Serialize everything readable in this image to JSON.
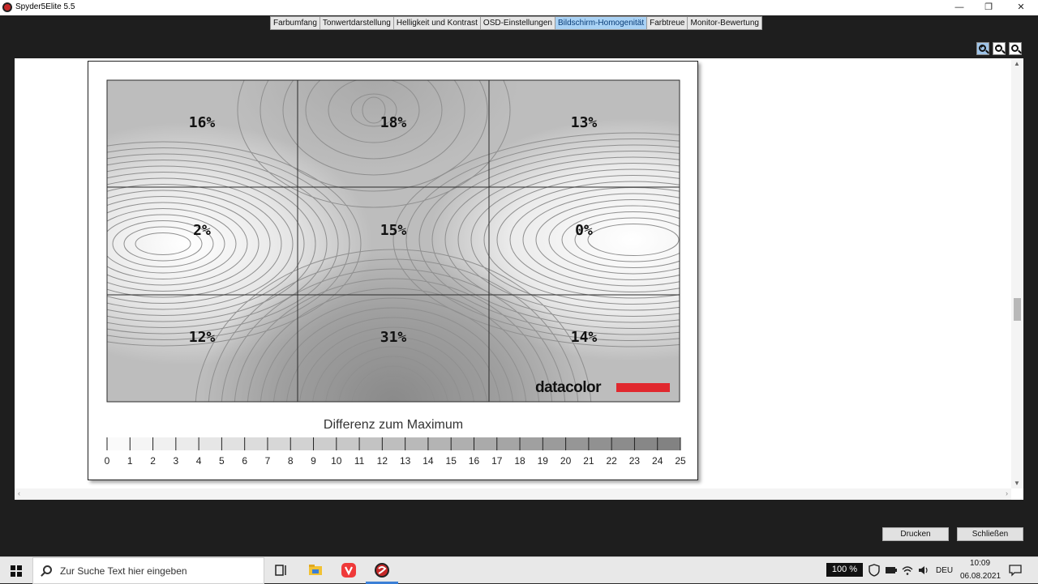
{
  "window": {
    "title": "Spyder5Elite 5.5",
    "minimize_glyph": "—",
    "restore_glyph": "❐",
    "close_glyph": "✕"
  },
  "tabs": [
    {
      "label": "Farbumfang",
      "active": false
    },
    {
      "label": "Tonwertdarstellung",
      "active": false
    },
    {
      "label": "Helligkeit und Kontrast",
      "active": false
    },
    {
      "label": "OSD-Einstellungen",
      "active": false
    },
    {
      "label": "Bildschirm-Homogenität",
      "active": true
    },
    {
      "label": "Farbtreue",
      "active": false
    },
    {
      "label": "Monitor-Bewertung",
      "active": false
    }
  ],
  "zoom_tools": [
    {
      "name": "zoom-in-icon",
      "sign": "+"
    },
    {
      "name": "zoom-out-icon",
      "sign": "−"
    },
    {
      "name": "zoom-reset-icon",
      "sign": ""
    }
  ],
  "report": {
    "cells": [
      "16%",
      "18%",
      "13%",
      "2%",
      "15%",
      "0%",
      "12%",
      "31%",
      "14%"
    ],
    "logo": "datacolor",
    "logo_bar_color": "#e0282e",
    "legend_title": "Differenz zum Maximum",
    "legend_ticks": [
      "0",
      "1",
      "2",
      "3",
      "4",
      "5",
      "6",
      "7",
      "8",
      "9",
      "10",
      "11",
      "12",
      "13",
      "14",
      "15",
      "16",
      "17",
      "18",
      "19",
      "20",
      "21",
      "22",
      "23",
      "24",
      "25"
    ]
  },
  "buttons": {
    "print": "Drucken",
    "close": "Schließen"
  },
  "taskbar": {
    "search_placeholder": "Zur Suche Text hier eingeben",
    "zoom": "100 %",
    "language": "DEU",
    "time": "10:09",
    "date": "06.08.2021"
  }
}
